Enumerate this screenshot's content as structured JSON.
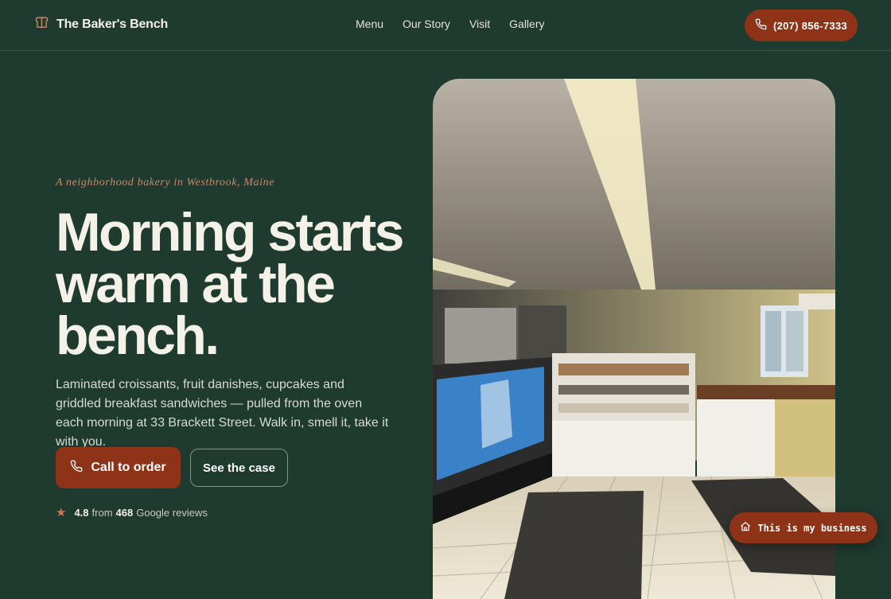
{
  "brand": {
    "name": "The Baker's Bench",
    "icon": "bread-icon"
  },
  "nav": {
    "links": [
      "Menu",
      "Our Story",
      "Visit",
      "Gallery"
    ],
    "phone_label": "(207) 856-7333",
    "phone_icon": "phone-icon"
  },
  "hero": {
    "eyebrow": "A neighborhood bakery in Westbrook, Maine",
    "headline": "Morning starts warm at the bench.",
    "lede": "Laminated croissants, fruit danishes, cupcakes and griddled breakfast sandwiches — pulled from the oven each morning at 33 Brackett Street. Walk in, smell it, take it with you.",
    "primary_button": "Call to order",
    "secondary_button": "See the case"
  },
  "rating": {
    "score": "4.8",
    "from": "from",
    "count": "468",
    "suffix": "Google reviews",
    "icon": "star-icon"
  },
  "photo": {
    "subject": "bakery interior with display cases"
  },
  "owner_button": {
    "label": "This is my business",
    "icon": "storefront-icon"
  },
  "colors": {
    "background": "#1f3a2f",
    "accent": "#8e3317",
    "eyebrow": "#c98a6c",
    "text": "#f3f1e8"
  }
}
